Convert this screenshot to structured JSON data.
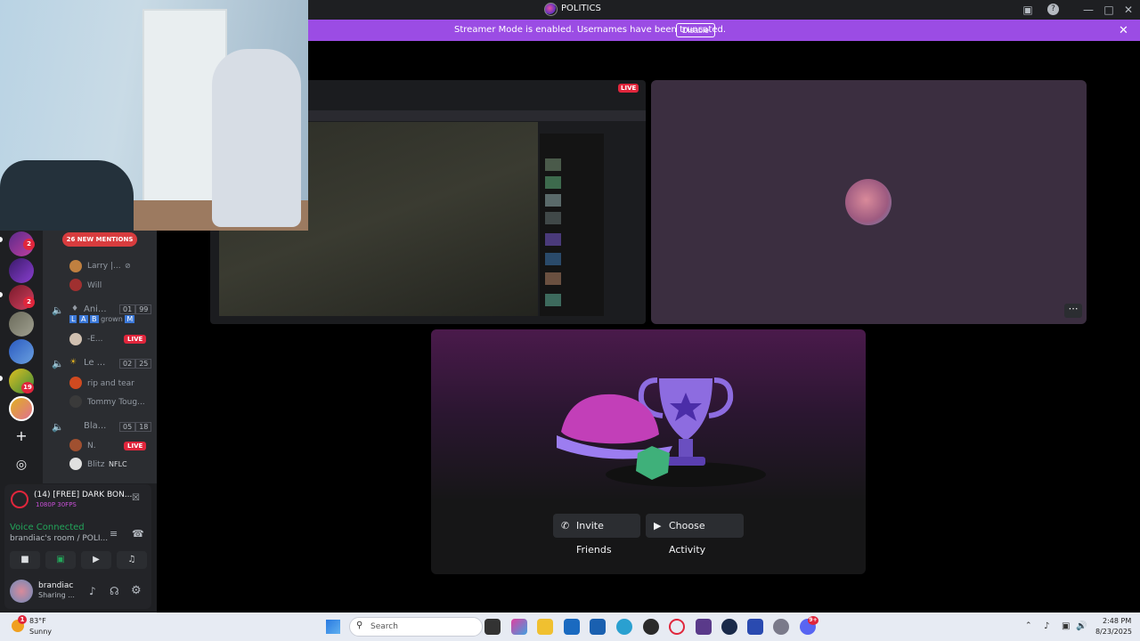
{
  "window": {
    "title": "POLITICS",
    "icons": [
      "screen-icon",
      "help-icon",
      "minimize-icon",
      "maximize-icon",
      "close-icon"
    ]
  },
  "banner": {
    "message": "Streamer Mode is enabled. Usernames have been truncated.",
    "disable_label": "Disable",
    "close_glyph": "✕",
    "color": "#9b4ce4"
  },
  "stage": {
    "live_label": "LIVE",
    "more_glyph": "⋯",
    "invite_label": "Invite Friends",
    "activity_label": "Choose Activity"
  },
  "servers": {
    "badges": [
      "2",
      "2",
      "19"
    ],
    "add_glyph": "+",
    "discover_glyph": "◎"
  },
  "channels": {
    "mentions_label": "26 NEW MENTIONS",
    "users": [
      {
        "name": "Larry |..."
      },
      {
        "name": "Will"
      }
    ],
    "voice_channels": [
      {
        "name": "Ani...",
        "count_a": "01",
        "count_b": "99",
        "tags": [
          "L",
          "A",
          "B"
        ],
        "tag_suffix": "grown",
        "tag_m": "M"
      },
      {
        "name": "Le ...",
        "count_a": "02",
        "count_b": "25"
      },
      {
        "name": "Bla...",
        "count_a": "05",
        "count_b": "18"
      }
    ],
    "members": [
      {
        "name": "-E...",
        "live": "LIVE"
      },
      {
        "name": "rip and tear"
      },
      {
        "name": "Tommy Toug..."
      },
      {
        "name": "N.",
        "live": "LIVE"
      },
      {
        "name": "Blitz",
        "tag": "NFLC"
      }
    ]
  },
  "voice": {
    "stream_title": "(14) [FREE] DARK BON...",
    "stream_quality": "1080P 30FPS",
    "status": "Voice Connected",
    "room": "brandiac's room / POLI...",
    "username": "brandiac",
    "user_status": "Sharing ..."
  },
  "taskbar": {
    "temp": "83°F",
    "condition": "Sunny",
    "weather_badge": "1",
    "search_placeholder": "Search",
    "time": "2:48 PM",
    "date": "8/23/2025",
    "discord_badge": "9+"
  },
  "colors": {
    "accent": "#9b4ce4",
    "live": "#e0263c",
    "connected": "#23a55a"
  }
}
